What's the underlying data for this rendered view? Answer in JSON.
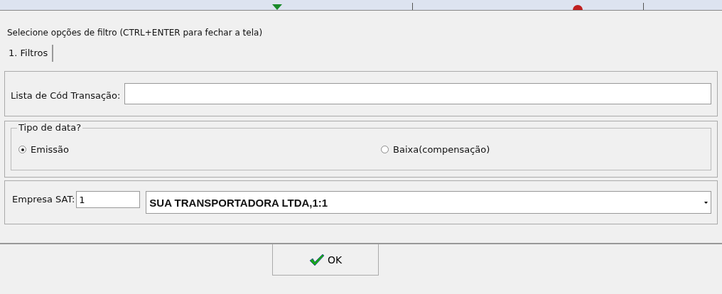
{
  "instruction": "Selecione opções de filtro (CTRL+ENTER para fechar a tela)",
  "tabs": [
    {
      "label": "1. Filtros",
      "selected": true
    }
  ],
  "transaction_list": {
    "label": "Lista de Cód Transação:"
  },
  "date_type": {
    "title": "Tipo de data?",
    "options": [
      {
        "label": "Emissão",
        "selected": true
      },
      {
        "label": "Baixa(compensação)",
        "selected": false
      }
    ]
  },
  "company": {
    "label": "Empresa SAT:",
    "code": "1",
    "selection": "SUA TRANSPORTADORA LTDA,1:1"
  },
  "ok_button": {
    "label": "OK"
  }
}
